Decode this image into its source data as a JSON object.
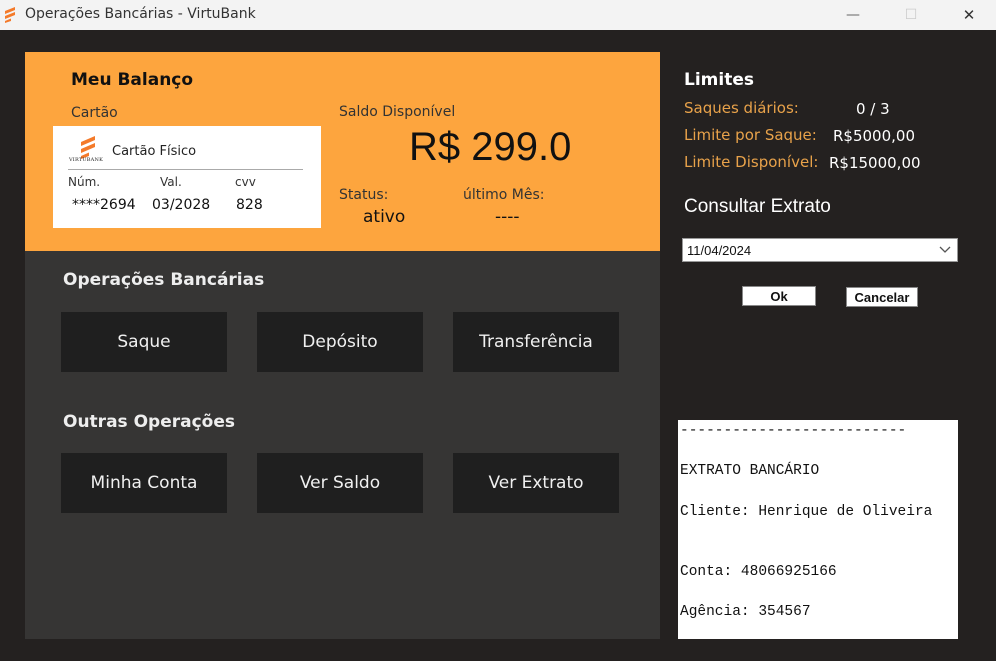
{
  "window": {
    "title": "Operações Bancárias - VirtuBank",
    "minimize_glyph": "—",
    "maximize_glyph": "☐",
    "close_glyph": "✕",
    "icon": "virtubank-logo-icon",
    "accent": "#fda53e"
  },
  "balance": {
    "title": "Meu Balanço",
    "card_label": "Cartão",
    "card": {
      "brand_text": "VIRTUBANK",
      "type": "Cartão Físico",
      "number_header": "Núm.",
      "validity_header": "Val.",
      "cvv_header": "cvv",
      "number": "****2694",
      "validity": "03/2028",
      "cvv": "828"
    },
    "saldo_label": "Saldo Disponível",
    "saldo_value": "R$ 299.0",
    "status_label": "Status:",
    "status_value": "ativo",
    "ultimo_label": "último Mês:",
    "ultimo_value": "----"
  },
  "operations": {
    "title": "Operações Bancárias",
    "buttons": [
      "Saque",
      "Depósito",
      "Transferência"
    ],
    "other_title": "Outras Operações",
    "other_buttons": [
      "Minha Conta",
      "Ver Saldo",
      "Ver Extrato"
    ]
  },
  "limits": {
    "title": "Limites",
    "items": [
      {
        "label": "Saques diários:",
        "value": "0 / 3"
      },
      {
        "label": "Limite por Saque:",
        "value": "R$5000,00"
      },
      {
        "label": "Limite Disponível:",
        "value": "R$15000,00"
      }
    ]
  },
  "extrato": {
    "title": "Consultar Extrato",
    "date_value": "11/04/2024",
    "ok_label": "Ok",
    "cancel_label": "Cancelar",
    "statement": {
      "separator": "--------------------------",
      "heading": "EXTRATO BANCÁRIO",
      "cliente": "Cliente: Henrique de Oliveira",
      "conta": "Conta: 48066925166",
      "agencia": "Agência: 354567"
    }
  }
}
